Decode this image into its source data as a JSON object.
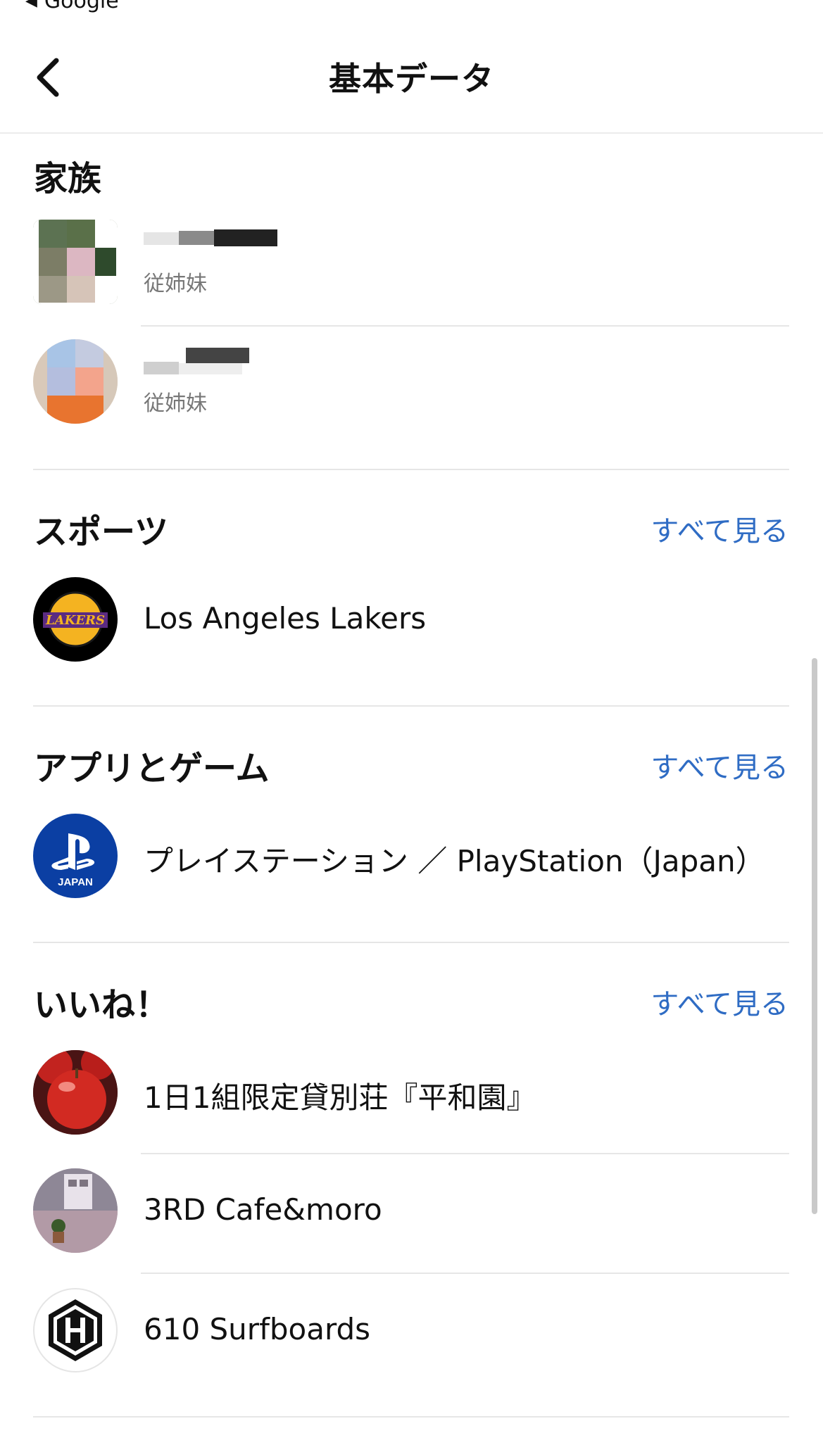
{
  "status": {
    "back_app": "Google"
  },
  "header": {
    "title": "基本データ"
  },
  "family": {
    "title": "家族",
    "members": [
      {
        "relation": "従姉妹"
      },
      {
        "relation": "従姉妹"
      }
    ]
  },
  "sports": {
    "title": "スポーツ",
    "see_all": "すべて見る",
    "items": [
      {
        "label": "Los Angeles Lakers",
        "logo_text": "LAKERS"
      }
    ]
  },
  "apps": {
    "title": "アプリとゲーム",
    "see_all": "すべて見る",
    "items": [
      {
        "label": "プレイステーション ／ PlayStation（Japan）",
        "logo_text": "JAPAN"
      }
    ]
  },
  "likes": {
    "title": "いいね！",
    "see_all": "すべて見る",
    "items": [
      {
        "label": "1日1組限定貸別荘『平和園』"
      },
      {
        "label": "3RD Cafe&moro"
      },
      {
        "label": "610 Surfboards"
      }
    ]
  },
  "colors": {
    "link": "#2f6cc4",
    "divider": "#e6e6e6",
    "background": "#ffffff"
  },
  "icons": [
    "chevron-left-icon",
    "back-triangle-icon"
  ]
}
